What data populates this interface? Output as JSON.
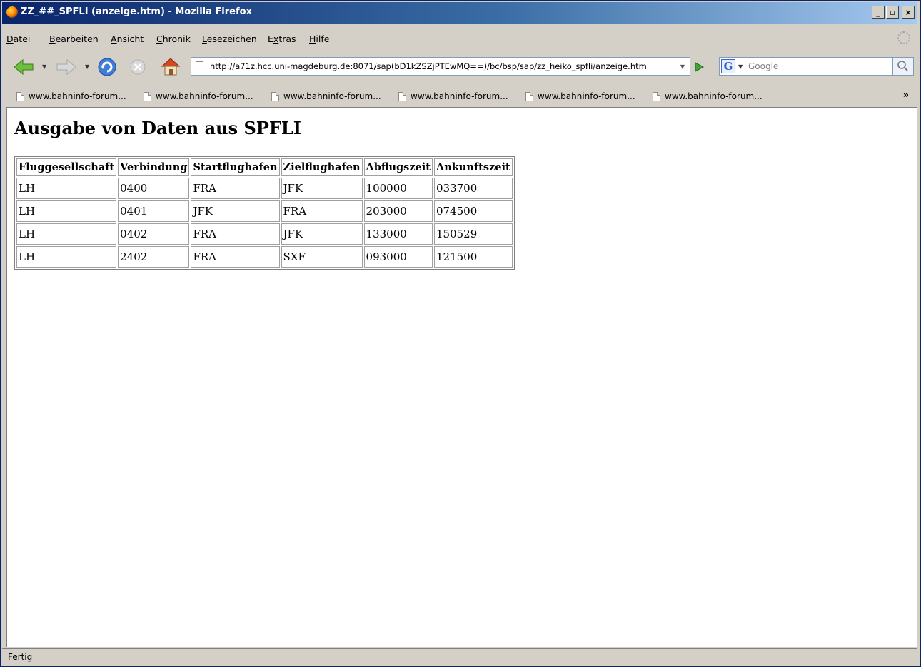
{
  "window": {
    "title": "ZZ_##_SPFLI (anzeige.htm) - Mozilla Firefox",
    "buttons": {
      "minimize": "_",
      "maximize": "▫",
      "close": "×"
    }
  },
  "menu": [
    {
      "pre": "",
      "u": "D",
      "post": "atei"
    },
    {
      "pre": "",
      "u": "B",
      "post": "earbeiten"
    },
    {
      "pre": "",
      "u": "A",
      "post": "nsicht"
    },
    {
      "pre": "",
      "u": "C",
      "post": "hronik"
    },
    {
      "pre": "",
      "u": "L",
      "post": "esezeichen"
    },
    {
      "pre": "E",
      "u": "x",
      "post": "tras"
    },
    {
      "pre": "",
      "u": "H",
      "post": "ilfe"
    }
  ],
  "navigation": {
    "url": "http://a71z.hcc.uni-magdeburg.de:8071/sap(bD1kZSZjPTEwMQ==)/bc/bsp/sap/zz_heiko_spfli/anzeige.htm",
    "search_placeholder": "Google",
    "search_engine": "G",
    "icons": [
      "back-icon",
      "forward-icon",
      "reload-icon",
      "stop-icon",
      "home-icon",
      "go-icon",
      "search-icon"
    ]
  },
  "bookmarks": {
    "items": [
      "www.bahninfo-forum...",
      "www.bahninfo-forum...",
      "www.bahninfo-forum...",
      "www.bahninfo-forum...",
      "www.bahninfo-forum...",
      "www.bahninfo-forum..."
    ],
    "overflow": "»"
  },
  "page": {
    "heading": "Ausgabe von Daten aus SPFLI",
    "table": {
      "headers": [
        "Fluggesellschaft",
        "Verbindung",
        "Startflughafen",
        "Zielflughafen",
        "Abflugszeit",
        "Ankunftszeit"
      ],
      "rows": [
        [
          "LH",
          "0400",
          "FRA",
          "JFK",
          "100000",
          "033700"
        ],
        [
          "LH",
          "0401",
          "JFK",
          "FRA",
          "203000",
          "074500"
        ],
        [
          "LH",
          "0402",
          "FRA",
          "JFK",
          "133000",
          "150529"
        ],
        [
          "LH",
          "2402",
          "FRA",
          "SXF",
          "093000",
          "121500"
        ]
      ]
    }
  },
  "status": {
    "text": "Fertig"
  }
}
